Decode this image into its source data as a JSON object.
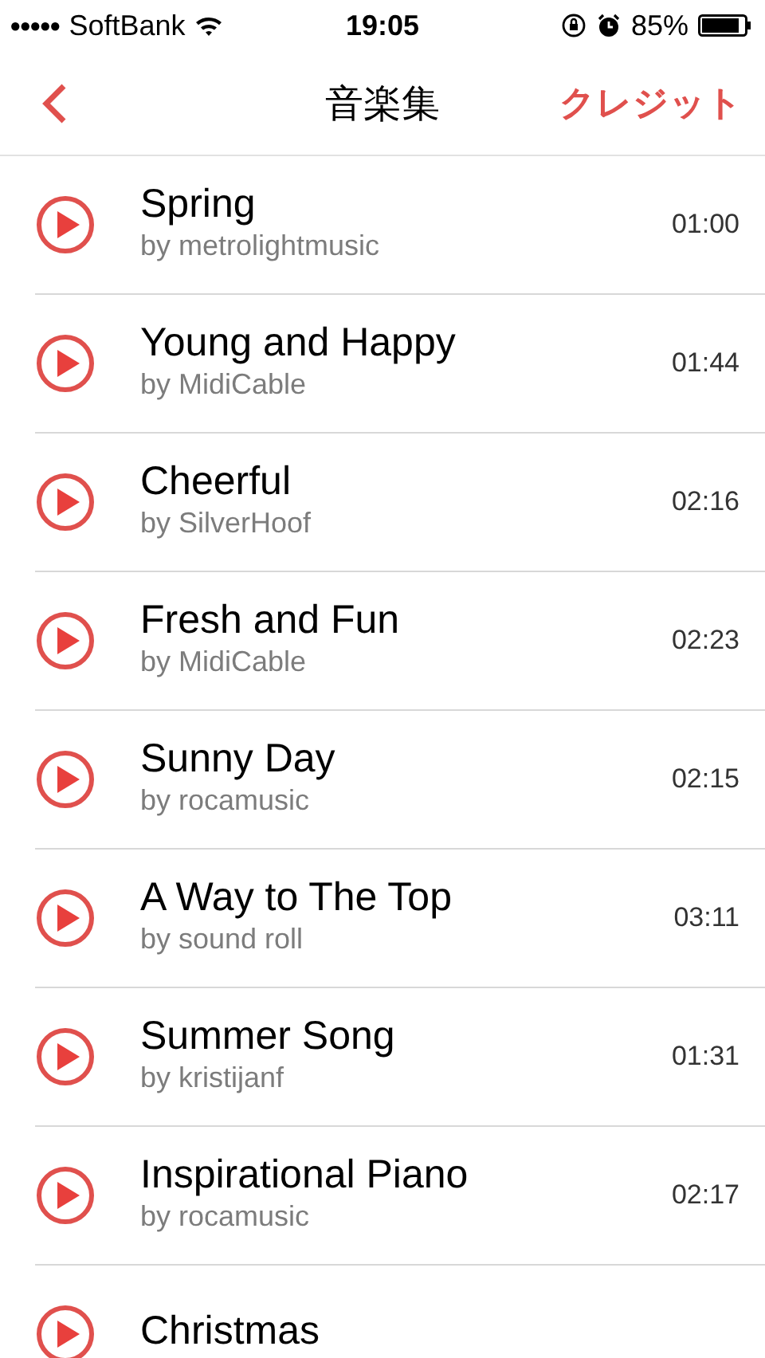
{
  "status_bar": {
    "signal_dots": "●●●●●",
    "carrier": "SoftBank",
    "time": "19:05",
    "battery": "85%"
  },
  "nav_bar": {
    "title": "音楽集",
    "right_button": "クレジット"
  },
  "tracks": [
    {
      "title": "Spring",
      "artist": "by metrolightmusic",
      "duration": "01:00"
    },
    {
      "title": "Young and Happy",
      "artist": "by MidiCable",
      "duration": "01:44"
    },
    {
      "title": "Cheerful",
      "artist": "by SilverHoof",
      "duration": "02:16"
    },
    {
      "title": "Fresh and Fun",
      "artist": "by MidiCable",
      "duration": "02:23"
    },
    {
      "title": "Sunny Day",
      "artist": "by rocamusic",
      "duration": "02:15"
    },
    {
      "title": "A Way to The Top",
      "artist": "by sound roll",
      "duration": "03:11"
    },
    {
      "title": "Summer Song",
      "artist": "by kristijanf",
      "duration": "01:31"
    },
    {
      "title": "Inspirational Piano",
      "artist": "by rocamusic",
      "duration": "02:17"
    },
    {
      "title": "Christmas"
    }
  ]
}
